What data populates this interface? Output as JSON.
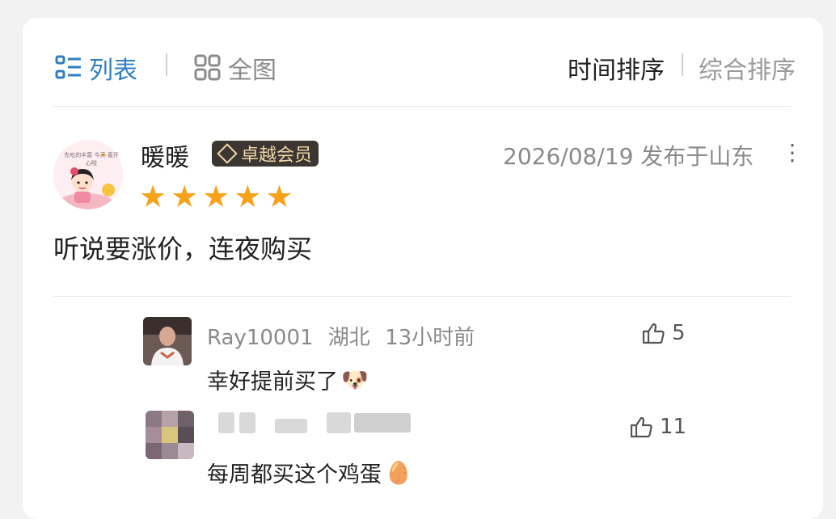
{
  "toolbar": {
    "list_label": "列表",
    "grid_label": "全图",
    "sort_time": "时间排序",
    "sort_all": "综合排序"
  },
  "review": {
    "username": "暖暖",
    "badge": "卓越会员",
    "rating": 5,
    "meta": "2026/08/19 发布于山东",
    "text": "听说要涨价，连夜购买",
    "avatar_text": "先吃的丰富 今天 喜开心啦"
  },
  "replies": [
    {
      "name": "Ray10001",
      "location": "湖北",
      "time": "13小时前",
      "text": "幸好提前买了",
      "emoji": "🐶",
      "likes": "5"
    },
    {
      "name": "",
      "text": "每周都买这个鸡蛋",
      "emoji": "🥚",
      "likes": "11"
    }
  ],
  "colors": {
    "accent": "#2f7fc1",
    "star": "#f7a21b",
    "badge_bg": "#3b3631",
    "badge_text": "#f1d7a6"
  },
  "icons": {
    "list": "list-view-icon",
    "grid": "grid-view-icon",
    "more": "more-vertical-icon",
    "like": "thumbs-up-icon"
  }
}
